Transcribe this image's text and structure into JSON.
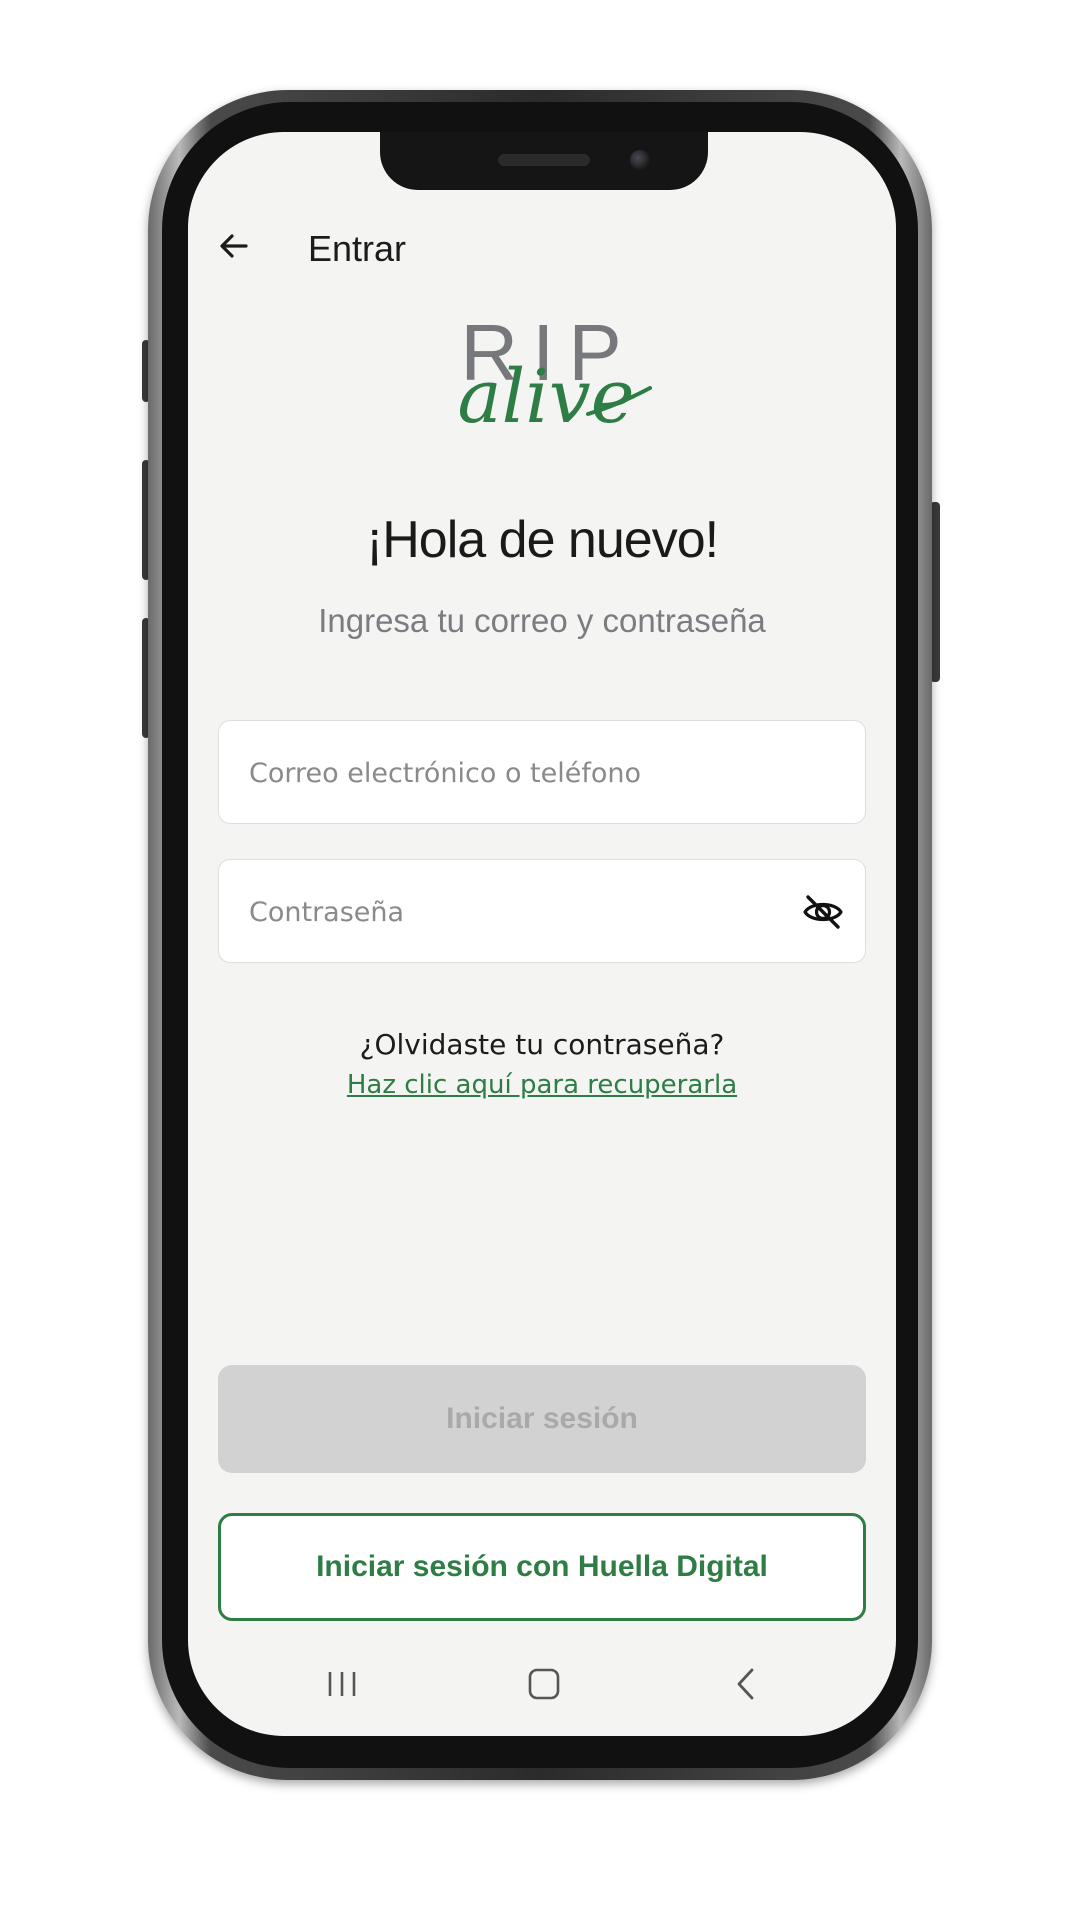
{
  "header": {
    "title": "Entrar"
  },
  "logo": {
    "top_text": "RIP",
    "script_text": "alive",
    "top_color": "#76787c",
    "script_color": "#2e7d45"
  },
  "main": {
    "greeting": "¡Hola de nuevo!",
    "subtitle": "Ingresa tu correo y contraseña",
    "email_field": {
      "placeholder": "Correo electrónico o teléfono",
      "value": ""
    },
    "password_field": {
      "placeholder": "Contraseña",
      "value": "",
      "toggle_icon": "eye-off-icon"
    },
    "forgot_question": "¿Olvidaste tu contraseña?",
    "forgot_link": "Haz clic aquí para recuperarla",
    "login_button": "Iniciar sesión",
    "fingerprint_button": "Iniciar sesión con Huella Digital"
  },
  "nav": {
    "recent_icon": "recent-apps-icon",
    "home_icon": "home-icon",
    "back_icon": "back-nav-icon"
  },
  "colors": {
    "accent": "#2e7d45",
    "screen_bg": "#f4f5f3",
    "disabled_button": "#d2d2d2",
    "disabled_text": "#a9a9a9"
  }
}
